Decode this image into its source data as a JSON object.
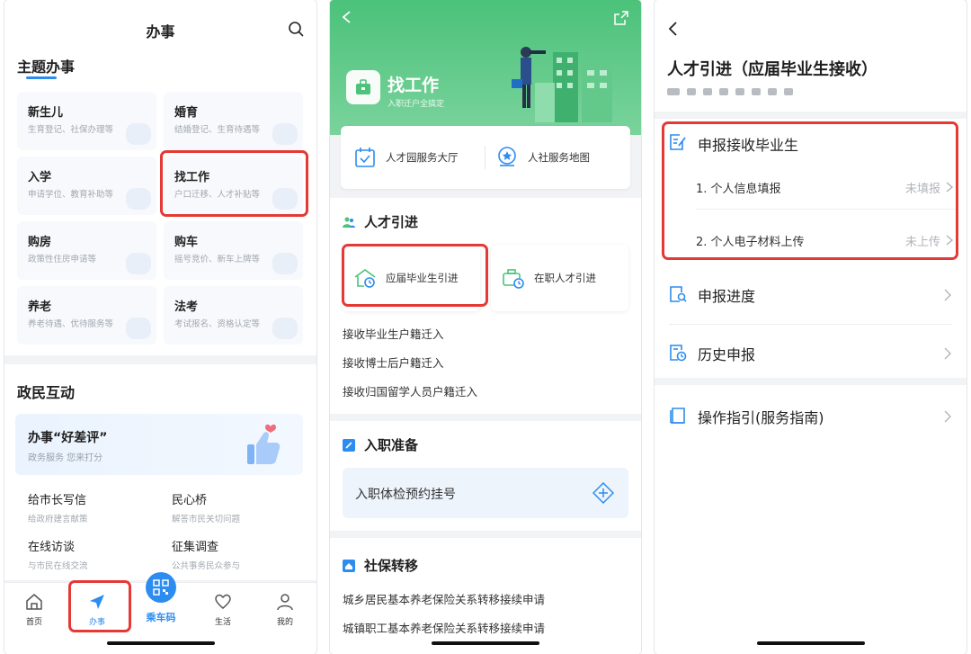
{
  "colors": {
    "brand_blue": "#2d8cf0",
    "green": "#4bc27a",
    "highlight_red": "#e53935"
  },
  "phone1": {
    "header_title": "办事",
    "topic_title": "主题办事",
    "tiles": [
      {
        "name": "新生儿",
        "sub": "生育登记、社保办理等"
      },
      {
        "name": "婚育",
        "sub": "结婚登记、生育待遇等"
      },
      {
        "name": "入学",
        "sub": "申请学位、教育补助等"
      },
      {
        "name": "找工作",
        "sub": "户口迁移、人才补贴等"
      },
      {
        "name": "购房",
        "sub": "政策性住房申请等"
      },
      {
        "name": "购车",
        "sub": "摇号竞价、新车上牌等"
      },
      {
        "name": "养老",
        "sub": "养老待遇、优待服务等"
      },
      {
        "name": "法考",
        "sub": "考试报名、资格认定等"
      }
    ],
    "interaction_title": "政民互动",
    "banner_title": "办事“好差评”",
    "banner_sub": "政务服务 您来打分",
    "grid": [
      {
        "name": "给市长写信",
        "sub": "给政府建言献策"
      },
      {
        "name": "民心桥",
        "sub": "解答市民关切问题"
      },
      {
        "name": "在线访谈",
        "sub": "与市民在线交流"
      },
      {
        "name": "征集调查",
        "sub": "公共事务民众参与"
      }
    ],
    "tabs": {
      "home": "首页",
      "service": "办事",
      "bus": "乘车码",
      "life": "生活",
      "mine": "我的"
    }
  },
  "phone2": {
    "title": "找工作",
    "subtitle": "入职迁户全搞定",
    "services": {
      "hall": "人才园服务大厅",
      "map": "人社服务地图"
    },
    "talent_title": "人才引进",
    "grad_intro": "应届毕业生引进",
    "employed_intro": "在职人才引进",
    "links": [
      "接收毕业生户籍迁入",
      "接收博士后户籍迁入",
      "接收归国留学人员户籍迁入"
    ],
    "onboard_title": "入职准备",
    "appointment": "入职体检预约挂号",
    "social_title": "社保转移",
    "social_links": [
      "城乡居民基本养老保险关系转移接续申请",
      "城镇职工基本养老保险关系转移接续申请"
    ]
  },
  "phone3": {
    "title": "人才引进（应届毕业生接收）",
    "apply_title": "申报接收毕业生",
    "steps": [
      {
        "label": "1. 个人信息填报",
        "status": "未填报"
      },
      {
        "label": "2. 个人电子材料上传",
        "status": "未上传"
      }
    ],
    "progress": "申报进度",
    "history": "历史申报",
    "guide": "操作指引(服务指南)"
  }
}
